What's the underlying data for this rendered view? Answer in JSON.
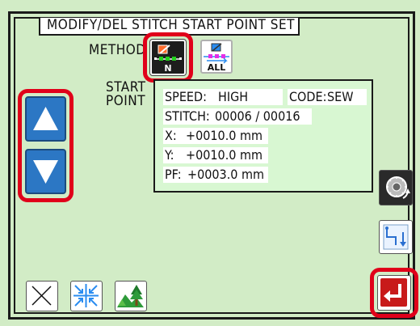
{
  "screen": {
    "title": "MODIFY/DEL STITCH  START POINT SET",
    "method_label": "METHOD",
    "start_point_label_1": "START",
    "start_point_label_2": "POINT"
  },
  "method_buttons": [
    {
      "name": "method-single-button",
      "badge": "N",
      "selected": true
    },
    {
      "name": "method-all-button",
      "badge": "ALL",
      "selected": false
    }
  ],
  "info": {
    "speed_label": "SPEED:",
    "speed_value": "HIGH",
    "code_label": "CODE:",
    "code_value": "SEW",
    "stitch_label": "STITCH:",
    "stitch_value": "00006 / 00016",
    "x_label": "X:",
    "x_value": "+0010.0 mm",
    "y_label": "Y:",
    "y_value": "+0010.0 mm",
    "pf_label": "PF:",
    "pf_value": "+0003.0 mm"
  },
  "colors": {
    "background": "#d2ecc6",
    "info_panel": "#d8f7d2",
    "highlight": "#e0001a",
    "arrow_button": "#2c77c4"
  },
  "icons": {
    "up": "triangle-up-icon",
    "down": "triangle-down-icon",
    "hand_wheel": "hand-wheel-icon",
    "feed": "feed-step-icon",
    "cancel": "cancel-x-icon",
    "center": "center-arrows-icon",
    "view": "landscape-view-icon",
    "enter": "enter-return-icon"
  }
}
